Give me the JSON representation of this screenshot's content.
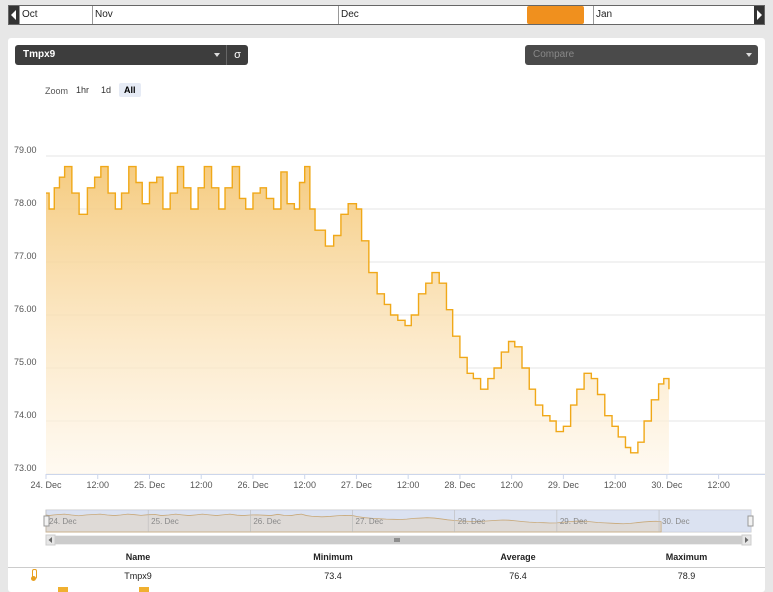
{
  "timeline": {
    "months": [
      "Oct",
      "Nov",
      "Dec",
      "Jan"
    ]
  },
  "toolbar": {
    "sensor_label": "Tmpx9",
    "sigma_label": "σ",
    "compare_placeholder": "Compare"
  },
  "zoom": {
    "label": "Zoom",
    "options": [
      "1hr",
      "1d",
      "All"
    ],
    "active": "All"
  },
  "colors": {
    "line": "#f0a818",
    "fill_top": "#f5c97a",
    "accent": "#f0901e",
    "navigator_mask": "#ccd6eb"
  },
  "chart_data": {
    "type": "area",
    "series": [
      {
        "name": "Tmpx9",
        "points": [
          [
            0.0,
            78.3
          ],
          [
            0.03,
            78.0
          ],
          [
            0.08,
            78.4
          ],
          [
            0.13,
            78.6
          ],
          [
            0.18,
            78.8
          ],
          [
            0.25,
            78.3
          ],
          [
            0.32,
            77.9
          ],
          [
            0.4,
            78.4
          ],
          [
            0.47,
            78.6
          ],
          [
            0.53,
            78.8
          ],
          [
            0.6,
            78.3
          ],
          [
            0.67,
            78.0
          ],
          [
            0.73,
            78.3
          ],
          [
            0.8,
            78.8
          ],
          [
            0.87,
            78.5
          ],
          [
            0.93,
            78.1
          ],
          [
            1.0,
            78.5
          ],
          [
            1.07,
            78.6
          ],
          [
            1.13,
            78.0
          ],
          [
            1.2,
            78.3
          ],
          [
            1.27,
            78.8
          ],
          [
            1.33,
            78.4
          ],
          [
            1.4,
            78.0
          ],
          [
            1.47,
            78.4
          ],
          [
            1.53,
            78.8
          ],
          [
            1.6,
            78.4
          ],
          [
            1.67,
            78.0
          ],
          [
            1.73,
            78.4
          ],
          [
            1.8,
            78.8
          ],
          [
            1.87,
            78.2
          ],
          [
            1.93,
            78.0
          ],
          [
            2.0,
            78.3
          ],
          [
            2.07,
            78.4
          ],
          [
            2.13,
            78.2
          ],
          [
            2.2,
            78.0
          ],
          [
            2.27,
            78.7
          ],
          [
            2.33,
            78.1
          ],
          [
            2.4,
            78.0
          ],
          [
            2.45,
            78.5
          ],
          [
            2.5,
            78.8
          ],
          [
            2.55,
            78.0
          ],
          [
            2.6,
            77.6
          ],
          [
            2.7,
            77.3
          ],
          [
            2.78,
            77.5
          ],
          [
            2.85,
            77.9
          ],
          [
            2.92,
            78.1
          ],
          [
            3.0,
            78.0
          ],
          [
            3.05,
            77.4
          ],
          [
            3.12,
            76.8
          ],
          [
            3.2,
            76.4
          ],
          [
            3.27,
            76.2
          ],
          [
            3.33,
            76.0
          ],
          [
            3.4,
            75.9
          ],
          [
            3.47,
            75.8
          ],
          [
            3.53,
            76.0
          ],
          [
            3.6,
            76.4
          ],
          [
            3.67,
            76.6
          ],
          [
            3.73,
            76.8
          ],
          [
            3.8,
            76.6
          ],
          [
            3.87,
            76.1
          ],
          [
            3.93,
            75.6
          ],
          [
            4.0,
            75.2
          ],
          [
            4.07,
            74.9
          ],
          [
            4.13,
            74.8
          ],
          [
            4.2,
            74.6
          ],
          [
            4.27,
            74.8
          ],
          [
            4.33,
            75.0
          ],
          [
            4.4,
            75.3
          ],
          [
            4.47,
            75.5
          ],
          [
            4.53,
            75.4
          ],
          [
            4.6,
            75.0
          ],
          [
            4.67,
            74.6
          ],
          [
            4.73,
            74.3
          ],
          [
            4.8,
            74.1
          ],
          [
            4.87,
            74.0
          ],
          [
            4.93,
            73.8
          ],
          [
            5.0,
            73.9
          ],
          [
            5.07,
            74.3
          ],
          [
            5.13,
            74.6
          ],
          [
            5.2,
            74.9
          ],
          [
            5.27,
            74.8
          ],
          [
            5.33,
            74.5
          ],
          [
            5.4,
            74.1
          ],
          [
            5.47,
            73.9
          ],
          [
            5.53,
            73.7
          ],
          [
            5.6,
            73.5
          ],
          [
            5.65,
            73.4
          ],
          [
            5.72,
            73.6
          ],
          [
            5.78,
            74.0
          ],
          [
            5.85,
            74.4
          ],
          [
            5.92,
            74.7
          ],
          [
            5.97,
            74.8
          ],
          [
            6.02,
            74.6
          ]
        ]
      }
    ],
    "x_tick_labels": [
      "24. Dec",
      "12:00",
      "25. Dec",
      "12:00",
      "26. Dec",
      "12:00",
      "27. Dec",
      "12:00",
      "28. Dec",
      "12:00",
      "29. Dec",
      "12:00",
      "30. Dec",
      "12:00"
    ],
    "y_tick_labels": [
      "73.00",
      "74.00",
      "75.00",
      "76.00",
      "77.00",
      "78.00",
      "79.00"
    ],
    "navigator_tick_labels": [
      "24. Dec",
      "25. Dec",
      "26. Dec",
      "27. Dec",
      "28. Dec",
      "29. Dec",
      "30. Dec"
    ],
    "ylim": [
      73,
      79
    ],
    "grid": true
  },
  "stats": {
    "headers": [
      "Name",
      "Minimum",
      "Average",
      "Maximum"
    ],
    "rows": [
      {
        "name": "Tmpx9",
        "min": "73.4",
        "avg": "76.4",
        "max": "78.9"
      }
    ]
  }
}
